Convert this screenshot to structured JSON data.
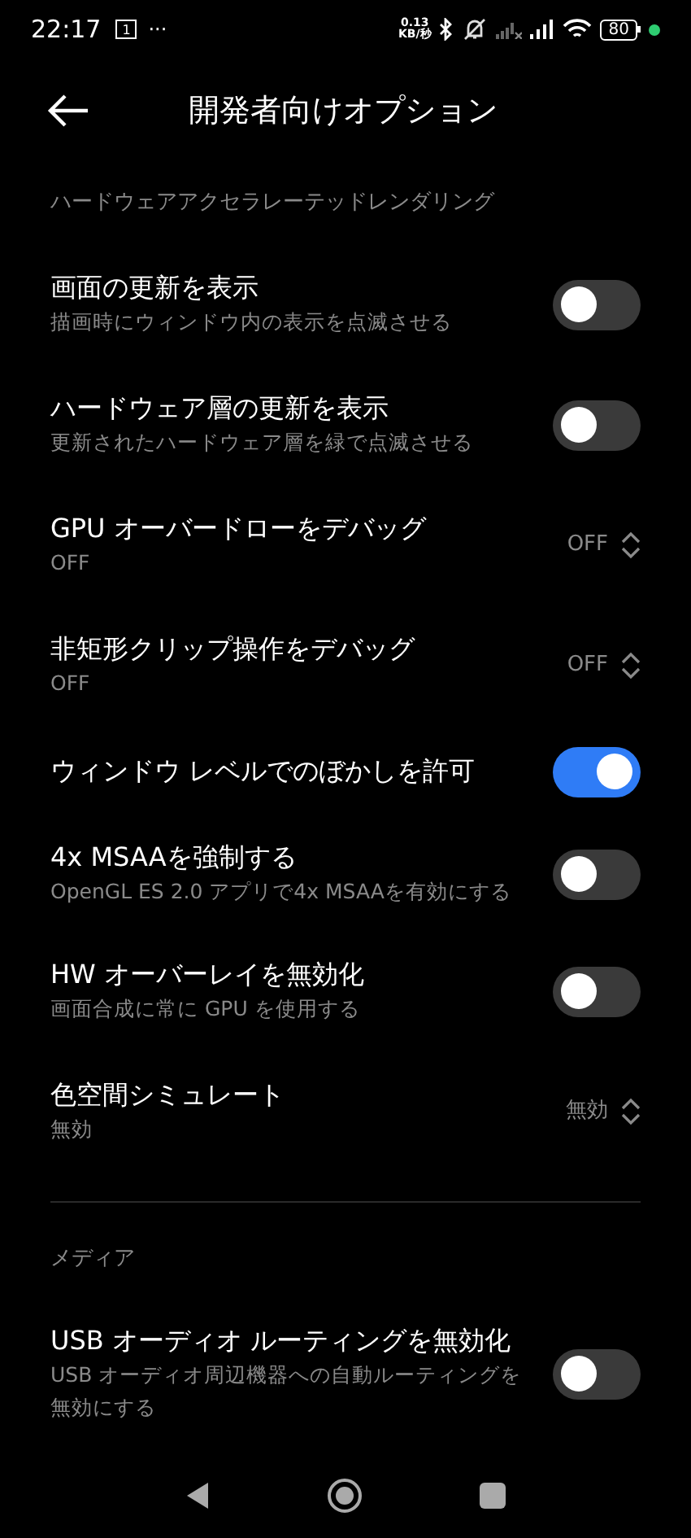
{
  "status_bar": {
    "time": "22:17",
    "calendar_day": "1",
    "more": "···",
    "net_speed": "0.13",
    "net_unit": "KB/秒",
    "battery": "80"
  },
  "toolbar": {
    "title": "開発者向けオプション"
  },
  "sections": [
    {
      "header": "ハードウェアアクセラレーテッドレンダリング",
      "items": [
        {
          "kind": "switch",
          "title": "画面の更新を表示",
          "summary": "描画時にウィンドウ内の表示を点滅させる",
          "on": false
        },
        {
          "kind": "switch",
          "title": "ハードウェア層の更新を表示",
          "summary": "更新されたハードウェア層を緑で点滅させる",
          "on": false
        },
        {
          "kind": "picker",
          "title": "GPU オーバードローをデバッグ",
          "summary": "OFF",
          "value": "OFF"
        },
        {
          "kind": "picker",
          "title": "非矩形クリップ操作をデバッグ",
          "summary": "OFF",
          "value": "OFF"
        },
        {
          "kind": "switch",
          "title": "ウィンドウ レベルでのぼかしを許可",
          "on": true
        },
        {
          "kind": "switch",
          "title": "4x MSAAを強制する",
          "summary": "OpenGL ES 2.0 アプリで4x MSAAを有効にする",
          "on": false
        },
        {
          "kind": "switch",
          "title": "HW オーバーレイを無効化",
          "summary": "画面合成に常に GPU を使用する",
          "on": false
        },
        {
          "kind": "picker",
          "title": "色空間シミュレート",
          "summary": "無効",
          "value": "無効"
        }
      ]
    },
    {
      "header": "メディア",
      "items": [
        {
          "kind": "switch",
          "title": "USB オーディオ ルーティングを無効化",
          "summary": "USB オーディオ周辺機器への自動ルーティングを無効にする",
          "on": false
        }
      ]
    }
  ]
}
